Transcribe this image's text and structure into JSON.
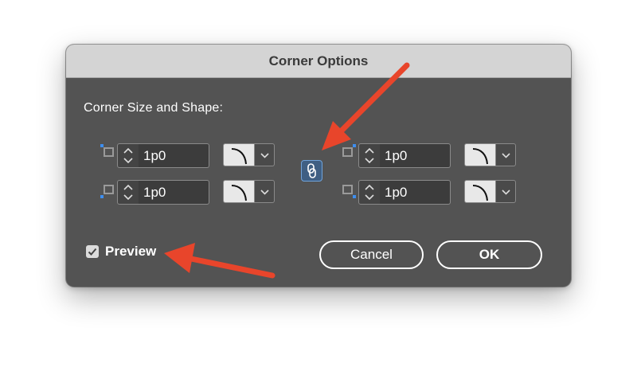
{
  "dialog": {
    "title": "Corner Options",
    "section_label": "Corner Size and Shape:",
    "corners": [
      {
        "name": "top-left",
        "value": "1p0",
        "shape_icon": "rounded-corner-icon"
      },
      {
        "name": "bottom-left",
        "value": "1p0",
        "shape_icon": "rounded-corner-icon"
      },
      {
        "name": "top-right",
        "value": "1p0",
        "shape_icon": "rounded-corner-icon"
      },
      {
        "name": "bottom-right",
        "value": "1p0",
        "shape_icon": "rounded-corner-icon"
      }
    ],
    "link_icon": "link-chain-icon",
    "preview": {
      "label": "Preview",
      "checked": true
    },
    "buttons": {
      "cancel": "Cancel",
      "ok": "OK"
    }
  },
  "annotations": {
    "arrow_color": "#e8452b"
  },
  "colors": {
    "dialog_bg": "#535353",
    "titlebar_bg": "#d4d4d4",
    "corner_marker": "#3d8ef0",
    "link_accent": "#6fa3db"
  }
}
